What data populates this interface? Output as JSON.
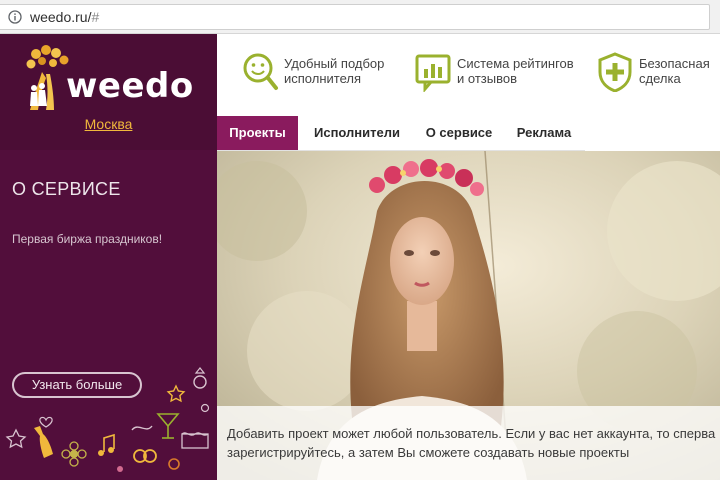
{
  "browser": {
    "url_host": "weedo.ru/",
    "url_hash": "#"
  },
  "brand": {
    "logo_text": "weedo",
    "city": "Москва"
  },
  "sidebar": {
    "title": "О СЕРВИСЕ",
    "subtitle": "Первая биржа праздников!",
    "more_button": "Узнать больше"
  },
  "features": [
    {
      "line1": "Удобный подбор",
      "line2": "исполнителя",
      "icon": "smiley-magnifier-icon"
    },
    {
      "line1": "Система рейтингов",
      "line2": "и отзывов",
      "icon": "rating-chart-icon"
    },
    {
      "line1": "Безопасная",
      "line2": "сделка",
      "icon": "shield-plus-icon"
    }
  ],
  "nav": {
    "items": [
      "Проекты",
      "Исполнители",
      "О сервисе",
      "Реклама"
    ],
    "active_index": 0
  },
  "hero": {
    "caption": "Добавить проект может любой пользователь. Если у вас нет аккаунта, то сперва зарегистрируйтесь, а затем Вы сможете создавать новые проекты"
  },
  "colors": {
    "sidebar_bg": "#4b0d35",
    "accent": "#8a1b5e",
    "gold": "#f0b83c",
    "icon_green": "#9ab12e"
  }
}
